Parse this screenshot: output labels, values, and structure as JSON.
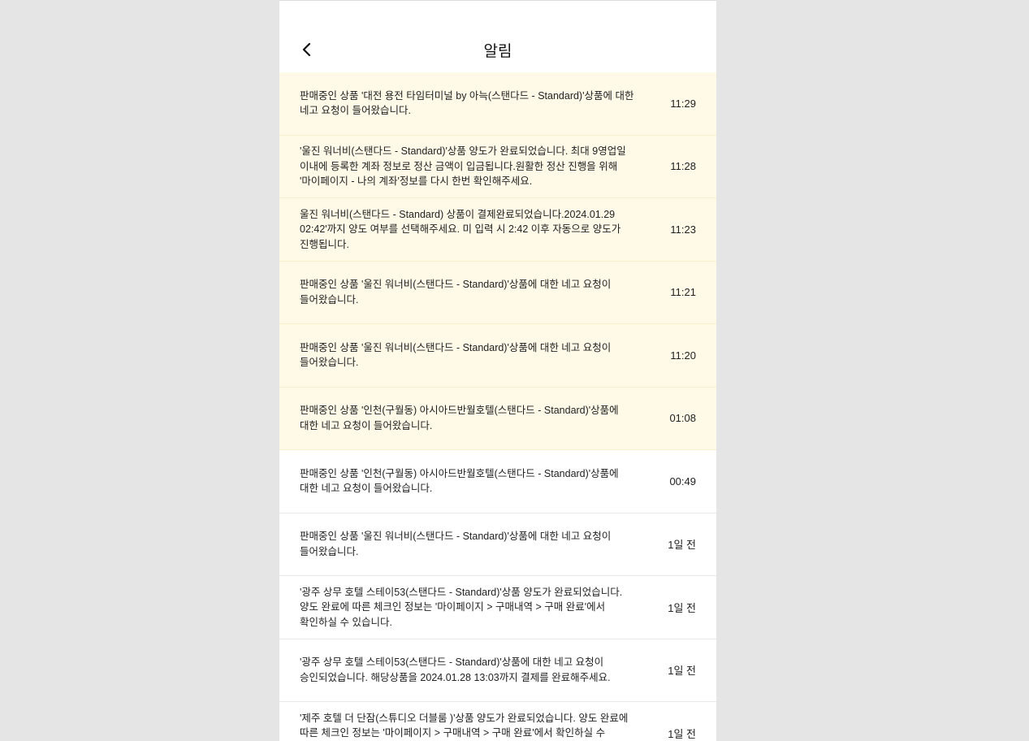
{
  "header": {
    "title": "알림",
    "back_icon": "chevron-left-icon"
  },
  "colors": {
    "unread_bg": "#fff9e8",
    "page_bg": "#e5e5e5"
  },
  "notifications": [
    {
      "message": "판매중인 상품 '대전 용전 타임터미널 by 아늑(스탠다드 - Standard)'상품에 대한 네고 요청이 들어왔습니다.",
      "time": "11:29",
      "unread": true
    },
    {
      "message": "'울진 워너비(스탠다드 - Standard)'상품 양도가 완료되었습니다. 최대 9영업일 이내에 등록한 계좌 정보로 정산 금액이 입금됩니다.원활한 정산 진행을 위해 '마이페이지 - 나의 계좌'정보를 다시 한번 확인해주세요.",
      "time": "11:28",
      "unread": true
    },
    {
      "message": "울진 워너비(스탠다드 - Standard) 상품이 결제완료되었습니다.2024.01.29 02:42'까지 양도 여부를 선택해주세요. 미 입력 시 2:42 이후 자동으로 양도가 진행됩니다.",
      "time": "11:23",
      "unread": true
    },
    {
      "message": "판매중인 상품 '울진 워너비(스탠다드 - Standard)'상품에 대한 네고 요청이 들어왔습니다.",
      "time": "11:21",
      "unread": true
    },
    {
      "message": "판매중인 상품 '울진 워너비(스탠다드 - Standard)'상품에 대한 네고 요청이 들어왔습니다.",
      "time": "11:20",
      "unread": true
    },
    {
      "message": "판매중인 상품 '인천(구월동) 아시아드반월호텔(스탠다드 - Standard)'상품에 대한 네고 요청이 들어왔습니다.",
      "time": "01:08",
      "unread": true
    },
    {
      "message": "판매중인 상품 '인천(구월동) 아시아드반월호텔(스탠다드 - Standard)'상품에 대한 네고 요청이 들어왔습니다.",
      "time": "00:49",
      "unread": false
    },
    {
      "message": "판매중인 상품 '울진 워너비(스탠다드 - Standard)'상품에 대한 네고 요청이 들어왔습니다.",
      "time": "1일 전",
      "unread": false
    },
    {
      "message": "'광주 상무 호텔 스테이53(스탠다드 - Standard)'상품 양도가 완료되었습니다. 양도 완료에 따른 체크인 정보는 '마이페이지 > 구매내역 > 구매 완료'에서 확인하실 수 있습니다.",
      "time": "1일 전",
      "unread": false
    },
    {
      "message": "'광주 상무 호텔 스테이53(스탠다드 - Standard)'상품에 대한 네고 요청이 승인되었습니다. 해당상품을 2024.01.28 13:03까지 결제를 완료해주세요.",
      "time": "1일 전",
      "unread": false
    },
    {
      "message": "'제주 호텔 더 단잠(스튜디오 더블룸 )'상품 양도가 완료되었습니다. 양도 완료에 따른 체크인 정보는 '마이페이지 > 구매내역 > 구매 완료'에서 확인하실 수 있습니다.",
      "time": "1일 전",
      "unread": false
    }
  ]
}
